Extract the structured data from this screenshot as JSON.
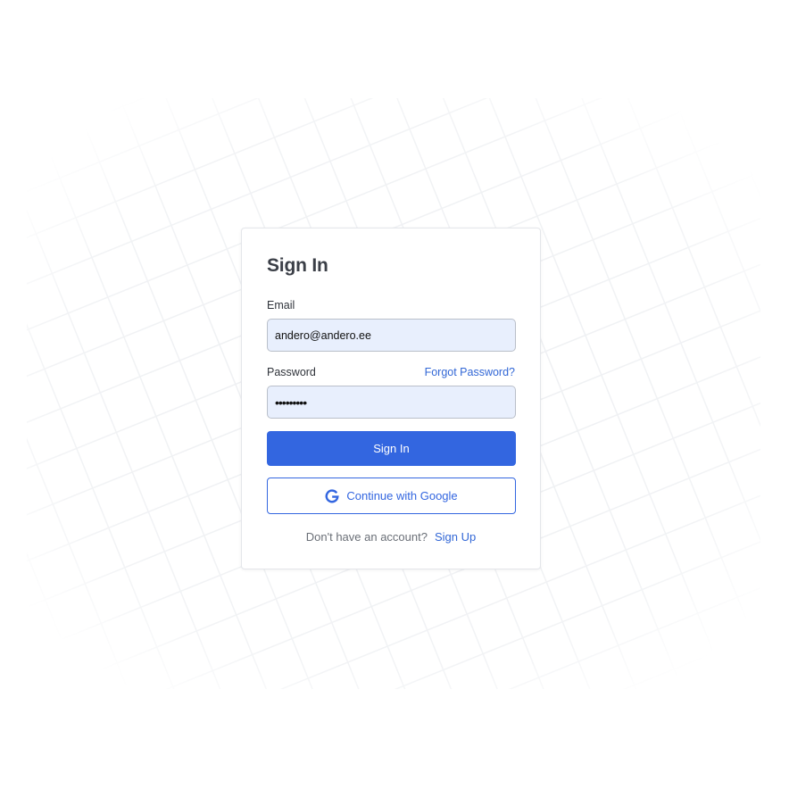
{
  "form": {
    "title": "Sign In",
    "email": {
      "label": "Email",
      "value": "andero@andero.ee"
    },
    "password": {
      "label": "Password",
      "value": "•••••••••",
      "forgot_link": "Forgot Password?"
    },
    "signin_button": "Sign In",
    "google_button": {
      "label": "Continue with Google",
      "icon": "google-icon"
    },
    "footer": {
      "text": "Don't have an account?",
      "signup_link": "Sign Up"
    }
  },
  "colors": {
    "accent": "#3366e0",
    "input_background": "#e8effd",
    "title": "#3b3f47",
    "muted_text": "#6a6f77"
  }
}
